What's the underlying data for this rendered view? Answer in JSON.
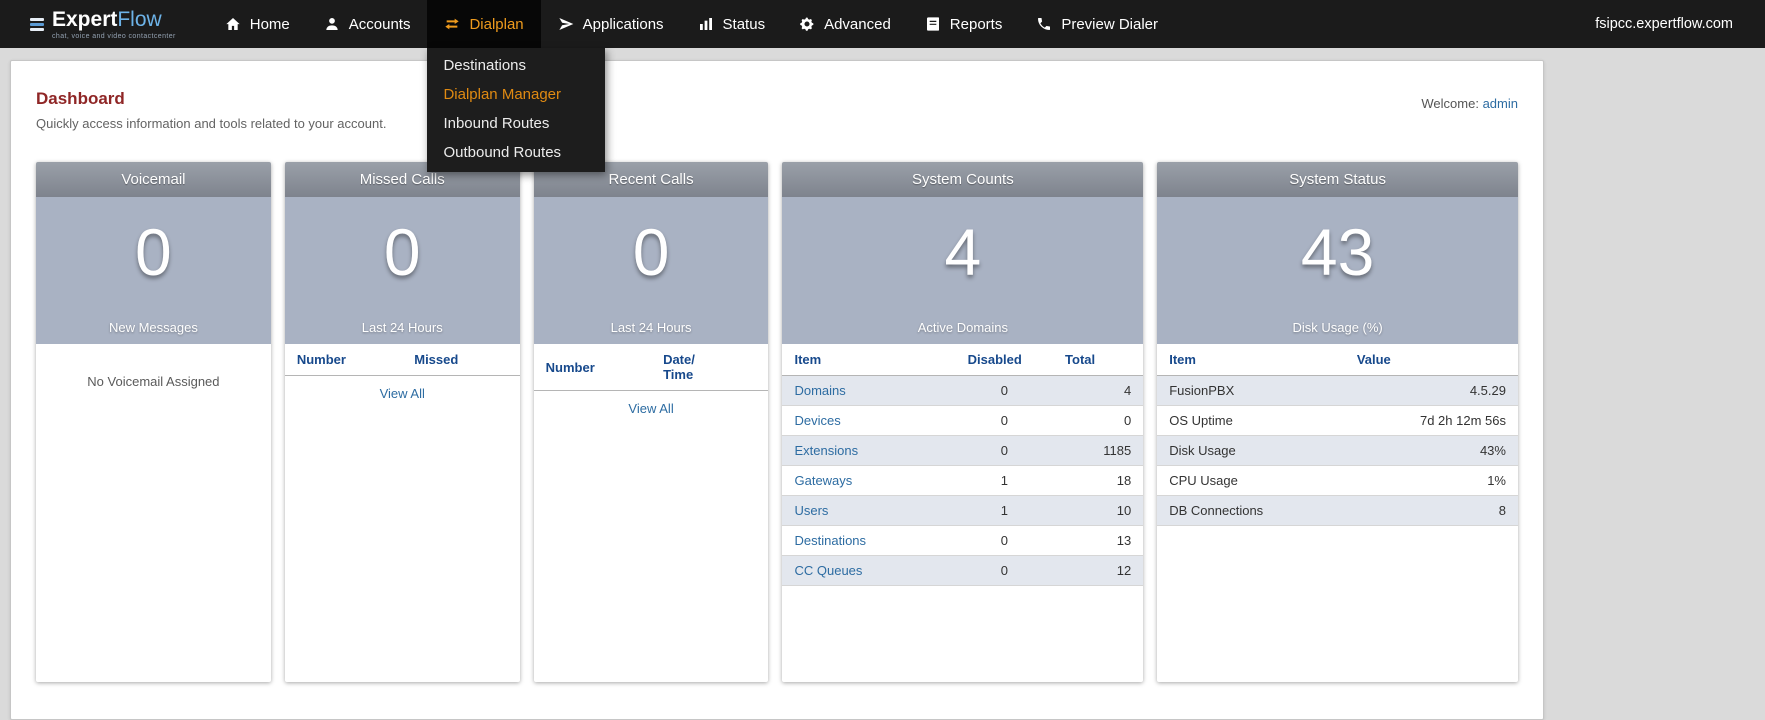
{
  "navbar": {
    "logo": {
      "part1": "Expert",
      "part2": "Flow",
      "subtitle": "chat, voice and video contactcenter",
      "icon": "logo-bars-icon",
      "accent_color": "#5b9bd5"
    },
    "items": [
      {
        "label": "Home",
        "icon": "home-icon"
      },
      {
        "label": "Accounts",
        "icon": "user-icon"
      },
      {
        "label": "Dialplan",
        "icon": "shuffle-icon",
        "active": true
      },
      {
        "label": "Applications",
        "icon": "paper-plane-icon"
      },
      {
        "label": "Status",
        "icon": "bar-chart-icon"
      },
      {
        "label": "Advanced",
        "icon": "gear-icon"
      },
      {
        "label": "Reports",
        "icon": "book-icon"
      },
      {
        "label": "Preview Dialer",
        "icon": "phone-icon"
      }
    ],
    "domain": "fsipcc.expertflow.com",
    "active_color": "#ef9b1d"
  },
  "dropdown": {
    "items": [
      {
        "label": "Destinations"
      },
      {
        "label": "Dialplan Manager",
        "active": true
      },
      {
        "label": "Inbound Routes"
      },
      {
        "label": "Outbound Routes"
      }
    ]
  },
  "header": {
    "title": "Dashboard",
    "subtitle": "Quickly access information and tools related to your account.",
    "welcome_label": "Welcome:",
    "welcome_user": "admin",
    "title_color": "#8f2626"
  },
  "cards": {
    "voicemail": {
      "title": "Voicemail",
      "stat": "0",
      "stat_label": "New Messages",
      "empty_text": "No Voicemail Assigned"
    },
    "missed_calls": {
      "title": "Missed Calls",
      "stat": "0",
      "stat_label": "Last 24 Hours",
      "col1": "Number",
      "col2": "Missed",
      "view_all": "View All"
    },
    "recent_calls": {
      "title": "Recent Calls",
      "stat": "0",
      "stat_label": "Last 24 Hours",
      "col1": "Number",
      "col2": "Date/\nTime",
      "view_all": "View All"
    },
    "system_counts": {
      "title": "System Counts",
      "stat": "4",
      "stat_label": "Active Domains",
      "col_item": "Item",
      "col_disabled": "Disabled",
      "col_total": "Total",
      "rows": [
        {
          "item": "Domains",
          "disabled": "0",
          "total": "4"
        },
        {
          "item": "Devices",
          "disabled": "0",
          "total": "0"
        },
        {
          "item": "Extensions",
          "disabled": "0",
          "total": "1185"
        },
        {
          "item": "Gateways",
          "disabled": "1",
          "total": "18"
        },
        {
          "item": "Users",
          "disabled": "1",
          "total": "10"
        },
        {
          "item": "Destinations",
          "disabled": "0",
          "total": "13"
        },
        {
          "item": "CC Queues",
          "disabled": "0",
          "total": "12"
        }
      ]
    },
    "system_status": {
      "title": "System Status",
      "stat": "43",
      "stat_label": "Disk Usage (%)",
      "col_item": "Item",
      "col_value": "Value",
      "rows": [
        {
          "item": "FusionPBX",
          "value": "4.5.29"
        },
        {
          "item": "OS Uptime",
          "value": "7d 2h 12m 56s"
        },
        {
          "item": "Disk Usage",
          "value": "43%"
        },
        {
          "item": "CPU Usage",
          "value": "1%"
        },
        {
          "item": "DB Connections",
          "value": "8"
        }
      ]
    }
  }
}
